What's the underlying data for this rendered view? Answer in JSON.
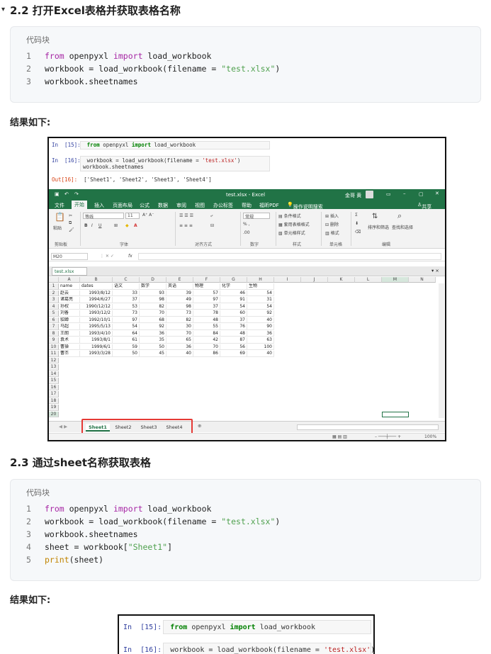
{
  "section1": {
    "toggle": "▾",
    "title": "2.2 打开Excel表格并获取表格名称",
    "code_label": "代码块",
    "lines": [
      {
        "n": "1",
        "code": "from openpyxl import load_workbook"
      },
      {
        "n": "2",
        "code": "workbook = load_workbook(filename = \"test.xlsx\")"
      },
      {
        "n": "3",
        "code": "workbook.sheetnames"
      }
    ],
    "result_label": "结果如下:"
  },
  "screenshot1": {
    "in15_prompt": "In  [15]:",
    "in15_code": "from openpyxl import load_workbook",
    "in16_prompt": "In  [16]:",
    "in16_line1": "workbook = load_workbook(filename = 'test.xlsx')",
    "in16_line2": "workbook.sheetnames",
    "out16_prompt": "Out[16]:",
    "out16_value": "['Sheet1', 'Sheet2', 'Sheet3', 'Sheet4']",
    "excel": {
      "window_title": "test.xlsx - Excel",
      "user": "金哥 黄",
      "share": "共享",
      "tabs": [
        "文件",
        "开始",
        "插入",
        "页面布局",
        "公式",
        "数据",
        "审阅",
        "视图",
        "办公标签",
        "帮助",
        "福昕PDF",
        "操作说明搜索"
      ],
      "ribbon_groups": [
        "剪贴板",
        "字体",
        "对齐方式",
        "数字",
        "样式",
        "单元格",
        "编辑"
      ],
      "ribbon_labels": {
        "paste": "粘贴",
        "font_name": "等线",
        "font_size": "11",
        "number_format": "常规",
        "conditional_format": "条件格式",
        "table_format": "套用表格格式",
        "cell_style": "单元格样式",
        "insert": "插入",
        "delete": "删除",
        "format": "格式",
        "sort_filter": "排序和筛选",
        "find_select": "查找和选择"
      },
      "name_box": "M20",
      "fx": "fx",
      "file_tab": "test.xlsx",
      "columns": [
        "A",
        "B",
        "C",
        "D",
        "E",
        "F",
        "G",
        "H",
        "I",
        "J",
        "K",
        "L",
        "M",
        "N"
      ],
      "headers": [
        "name",
        "dates",
        "语文",
        "数学",
        "英语",
        "物理",
        "化学",
        "生物"
      ],
      "rows": [
        [
          "赵云",
          "1993/8/12",
          "33",
          "93",
          "39",
          "57",
          "46",
          "54"
        ],
        [
          "诸葛亮",
          "1994/6/27",
          "37",
          "98",
          "49",
          "97",
          "91",
          "31"
        ],
        [
          "孙权",
          "1990/12/12",
          "53",
          "82",
          "98",
          "37",
          "54",
          "54"
        ],
        [
          "刘备",
          "1993/12/2",
          "73",
          "70",
          "73",
          "78",
          "60",
          "92"
        ],
        [
          "貂蝉",
          "1992/10/1",
          "97",
          "68",
          "82",
          "48",
          "37",
          "40"
        ],
        [
          "马超",
          "1995/5/13",
          "54",
          "92",
          "30",
          "55",
          "76",
          "90"
        ],
        [
          "王朗",
          "1993/4/10",
          "64",
          "36",
          "70",
          "84",
          "48",
          "36"
        ],
        [
          "袁术",
          "1993/8/1",
          "61",
          "35",
          "65",
          "42",
          "87",
          "63"
        ],
        [
          "曹操",
          "1999/6/1",
          "59",
          "50",
          "36",
          "70",
          "56",
          "100"
        ],
        [
          "曹丕",
          "1993/3/28",
          "50",
          "45",
          "40",
          "86",
          "69",
          "40"
        ]
      ],
      "row_numbers": [
        "1",
        "2",
        "3",
        "4",
        "5",
        "6",
        "7",
        "8",
        "9",
        "10",
        "11",
        "12",
        "13",
        "14",
        "15",
        "16",
        "17",
        "18",
        "19",
        "20"
      ],
      "sheets": [
        "Sheet1",
        "Sheet2",
        "Sheet3",
        "Sheet4"
      ],
      "zoom": "100%"
    }
  },
  "section2": {
    "title": "2.3 通过sheet名称获取表格",
    "code_label": "代码块",
    "lines": [
      {
        "n": "1",
        "code": "from openpyxl import load_workbook"
      },
      {
        "n": "2",
        "code": "workbook = load_workbook(filename = \"test.xlsx\")"
      },
      {
        "n": "3",
        "code": "workbook.sheetnames"
      },
      {
        "n": "4",
        "code": "sheet = workbook[\"Sheet1\"]"
      },
      {
        "n": "5",
        "code": "print(sheet)"
      }
    ],
    "result_label": "结果如下:"
  },
  "screenshot2": {
    "in15_prompt": "In  [15]:",
    "in15_code": "from openpyxl import load_workbook",
    "in16_prompt": "In  [16]:",
    "in16_code": "workbook = load_workbook(filename = 'test.xlsx')"
  }
}
